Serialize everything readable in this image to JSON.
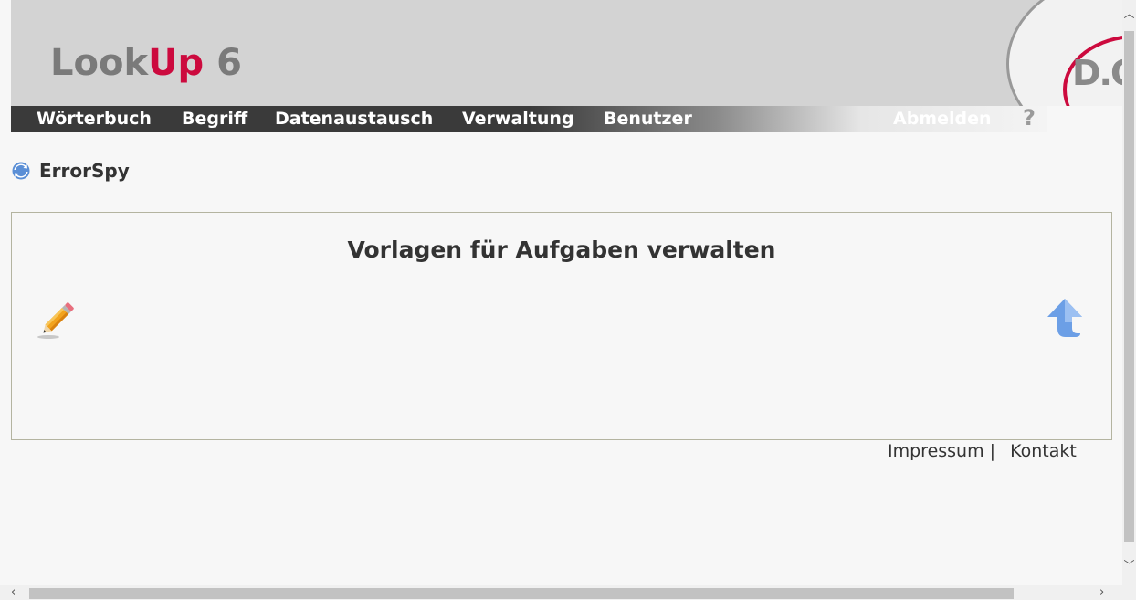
{
  "logo": {
    "look": "Look",
    "up": "Up",
    "version": " 6"
  },
  "brand": {
    "text": "D.C"
  },
  "nav": {
    "items": [
      "Wörterbuch",
      "Begriff",
      "Datenaustausch",
      "Verwaltung",
      "Benutzer"
    ],
    "logout": "Abmelden",
    "help": "?"
  },
  "page": {
    "heading": "ErrorSpy"
  },
  "panel": {
    "title": "Vorlagen für Aufgaben verwalten"
  },
  "footer": {
    "impressum": "Impressum",
    "separator": "|",
    "kontakt": "Kontakt"
  },
  "colors": {
    "brand_red": "#cc0a3e",
    "nav_dark": "#3a3a3a",
    "header_gray": "#d3d3d3"
  },
  "icons": {
    "heading": "refresh-icon",
    "edit": "pencil-icon",
    "back": "up-arrow-icon"
  }
}
